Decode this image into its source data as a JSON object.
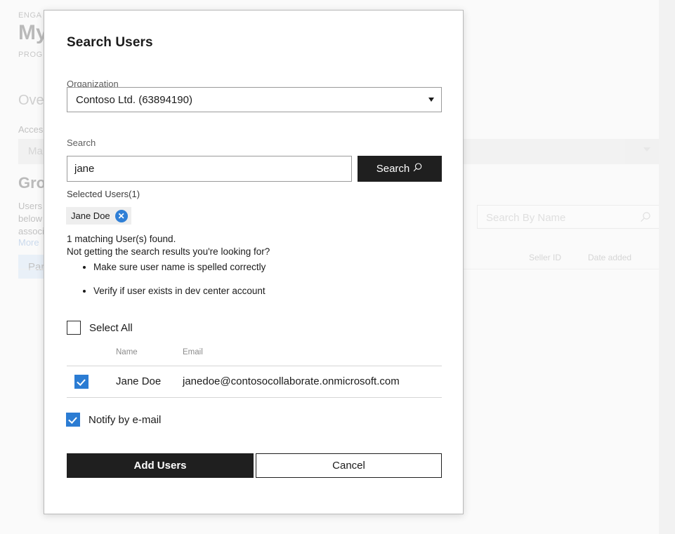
{
  "background": {
    "eyebrow_top": "ENGA",
    "page_title": "My",
    "eyebrow_second": "PROG",
    "tab_overview": "Ove",
    "access_label": "Acces",
    "access_dropdown_value": "Ma",
    "section_heading": "Gro",
    "body_line_1": "Users",
    "body_line_2": "below",
    "body_line_3": "associ",
    "more_link": "More",
    "pill_label": "Par",
    "search_placeholder": "Search By Name",
    "table_headers": [
      "Seller ID",
      "Date added"
    ]
  },
  "dialog": {
    "title": "Search Users",
    "organization": {
      "label": "Organization",
      "selected": "Contoso Ltd. (63894190)",
      "caret_icon": "chevron-down-icon"
    },
    "search": {
      "label": "Search",
      "value": "jane",
      "button_label": "Search",
      "button_icon": "search-icon"
    },
    "selected_users": {
      "label": "Selected Users(1)",
      "chips": [
        {
          "name": "Jane Doe",
          "remove_icon": "close-circle-icon",
          "remove_glyph": "✕"
        }
      ]
    },
    "messages": {
      "found": "1 matching User(s) found.",
      "not_getting": "Not getting the search results you're looking for?",
      "hints": [
        "Make sure user name is spelled correctly",
        "Verify if user exists in dev center account"
      ]
    },
    "select_all": {
      "label": "Select All",
      "checked": false
    },
    "results": {
      "columns": [
        "Name",
        "Email"
      ],
      "rows": [
        {
          "checked": true,
          "name": "Jane Doe",
          "email": "janedoe@contosocollaborate.onmicrosoft.com"
        }
      ]
    },
    "notify": {
      "label": "Notify by e-mail",
      "checked": true
    },
    "footer": {
      "primary_label": "Add Users",
      "secondary_label": "Cancel"
    }
  },
  "colors": {
    "accent_blue": "#2b7cd3",
    "chip_close_blue": "#2f7fd6",
    "button_dark": "#1f1f1f",
    "pill_blue": "#cfe0f5"
  }
}
